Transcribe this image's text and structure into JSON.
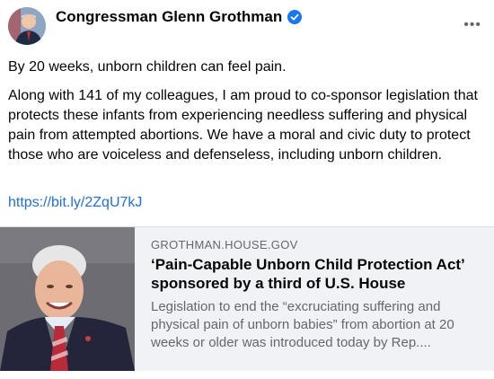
{
  "post": {
    "author": "Congressman Glenn Grothman",
    "more_label": "•••",
    "paragraphs": [
      "By 20 weeks, unborn children can feel pain.",
      "Along with 141 of my colleagues, I am proud to co-sponsor legislation that protects these infants from experiencing needless suffering and physical pain from attempted abortions. We have a moral and civic duty to protect those who are voiceless and defenseless, including unborn children."
    ],
    "link_text": "https://bit.ly/2ZqU7kJ"
  },
  "link_card": {
    "domain": "GROTHMAN.HOUSE.GOV",
    "headline": "‘Pain-Capable Unborn Child Protection Act’ sponsored by a third of U.S. House",
    "description": "Legislation to end the “excruciating suffering and physical pain of unborn babies” from abortion at 20 weeks or older was introduced today by Rep...."
  },
  "colors": {
    "link": "#216fdb",
    "verified": "#1877f2",
    "secondary_text": "#65676b",
    "card_bg": "#f0f2f5"
  },
  "icons": {
    "verified": "verified-badge-icon",
    "more": "more-options-icon"
  }
}
